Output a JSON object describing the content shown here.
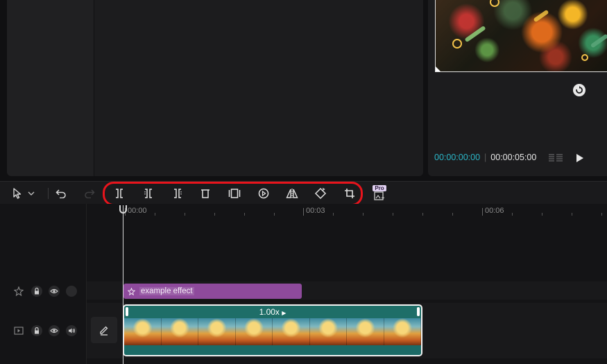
{
  "player": {
    "current_time": "00:00:00:00",
    "total_time": "00:00:05:00",
    "loop_icon": "loop-icon",
    "ratio_icon": "aspect-ratio-icon",
    "play_icon": "play-icon"
  },
  "toolbar": {
    "select_icon": "pointer-icon",
    "undo_icon": "undo-icon",
    "redo_icon": "redo-icon",
    "tools": [
      {
        "name": "split",
        "icon": "split-icon"
      },
      {
        "name": "trim-left",
        "icon": "trim-left-icon"
      },
      {
        "name": "trim-right",
        "icon": "trim-right-icon"
      },
      {
        "name": "delete",
        "icon": "trash-icon"
      },
      {
        "name": "freeze",
        "icon": "freeze-frame-icon"
      },
      {
        "name": "reverse",
        "icon": "reverse-play-icon"
      },
      {
        "name": "mirror",
        "icon": "mirror-icon"
      },
      {
        "name": "rotate",
        "icon": "rotate-icon"
      },
      {
        "name": "crop",
        "icon": "crop-icon"
      }
    ],
    "pro_badge": "Pro",
    "highlight_color": "#e8141c"
  },
  "timeline": {
    "ruler": [
      "00:00",
      "00:03",
      "00:06"
    ],
    "effect_clip": {
      "label": "example effect",
      "color": "#8e4a9c"
    },
    "video_clip": {
      "speed": "1.00x",
      "color": "#1e6e68"
    }
  },
  "colors": {
    "accent_time": "#2bb7c8",
    "background": "#101012"
  }
}
